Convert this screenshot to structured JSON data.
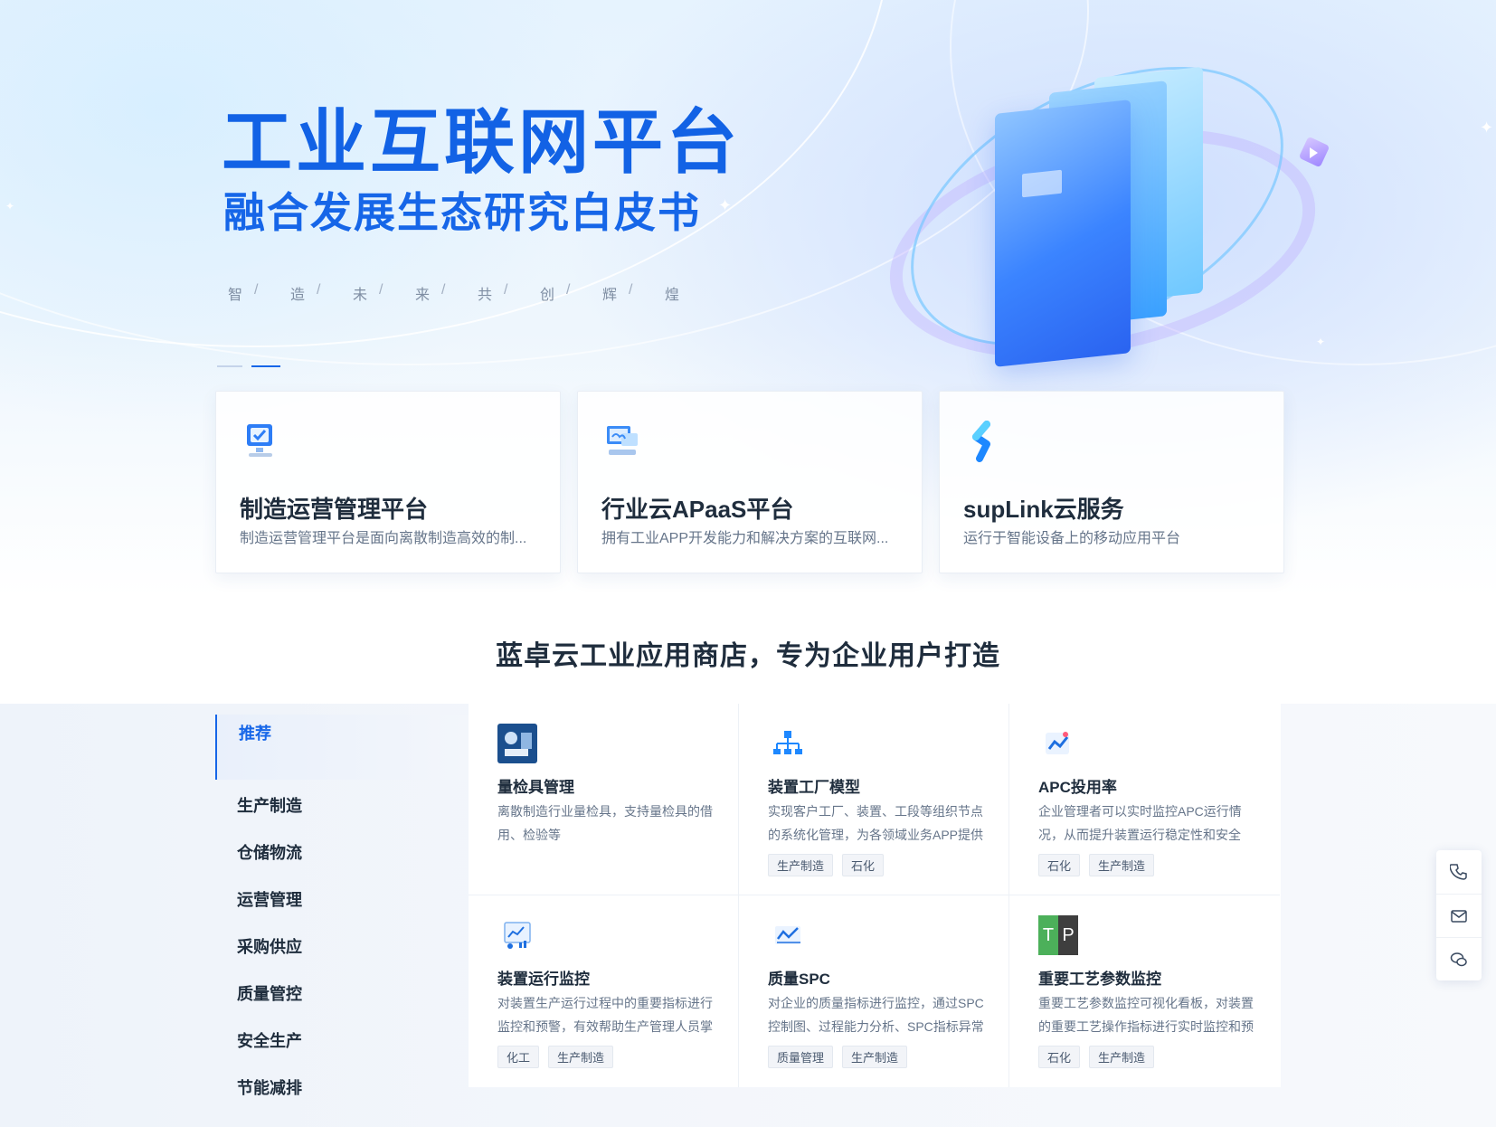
{
  "hero": {
    "title": "工业互联网平台",
    "subtitle": "融合发展生态研究白皮书",
    "slogan": [
      "智",
      "造",
      "未",
      "来",
      "共",
      "创",
      "辉",
      "煌"
    ],
    "slogan_separator": "/"
  },
  "products": [
    {
      "icon": "monitor-check-icon",
      "title": "制造运营管理平台",
      "desc": "制造运营管理平台是面向离散制造高效的制..."
    },
    {
      "icon": "server-cloud-icon",
      "title": "行业云APaaS平台",
      "desc": "拥有工业APP开发能力和解决方案的互联网..."
    },
    {
      "icon": "suplink-logo-icon",
      "title": "supLink云服务",
      "desc": "运行于智能设备上的移动应用平台"
    }
  ],
  "store": {
    "title": "蓝卓云工业应用商店，专为企业用户打造",
    "categories": [
      "推荐",
      "生产制造",
      "仓储物流",
      "运营管理",
      "采购供应",
      "质量管控",
      "安全生产",
      "节能减排"
    ],
    "active_category": "推荐",
    "apps": [
      {
        "icon": "gauge-tool-icon",
        "title": "量检具管理",
        "desc": "离散制造行业量检具，支持量检具的借用、检验等",
        "tags": []
      },
      {
        "icon": "factory-tree-icon",
        "title": "装置工厂模型",
        "desc": "实现客户工厂、装置、工段等组织节点的系统化管理，为各领域业务APP提供",
        "tags": [
          "生产制造",
          "石化"
        ]
      },
      {
        "icon": "trend-chart-icon",
        "title": "APC投用率",
        "desc": "企业管理者可以实时监控APC运行情况，从而提升装置运行稳定性和安全",
        "tags": [
          "石化",
          "生产制造"
        ]
      },
      {
        "icon": "monitor-chart-icon",
        "title": "装置运行监控",
        "desc": "对装置生产运行过程中的重要指标进行监控和预警，有效帮助生产管理人员掌",
        "tags": [
          "化工",
          "生产制造"
        ]
      },
      {
        "icon": "line-chart-icon",
        "title": "质量SPC",
        "desc": "对企业的质量指标进行监控，通过SPC控制图、过程能力分析、SPC指标异常",
        "tags": [
          "质量管理",
          "生产制造"
        ]
      },
      {
        "icon": "tp-logo-icon",
        "icon_text": [
          "T",
          "P"
        ],
        "title": "重要工艺参数监控",
        "desc": "重要工艺参数监控可视化看板，对装置的重要工艺操作指标进行实时监控和预",
        "tags": [
          "石化",
          "生产制造"
        ]
      }
    ]
  },
  "float_toolbar": [
    {
      "icon": "phone-icon"
    },
    {
      "icon": "mail-icon"
    },
    {
      "icon": "chat-icon"
    }
  ],
  "colors": {
    "brand_blue": "#1666e8",
    "text_dark": "#1f2d3d",
    "text_muted": "#66758a"
  }
}
